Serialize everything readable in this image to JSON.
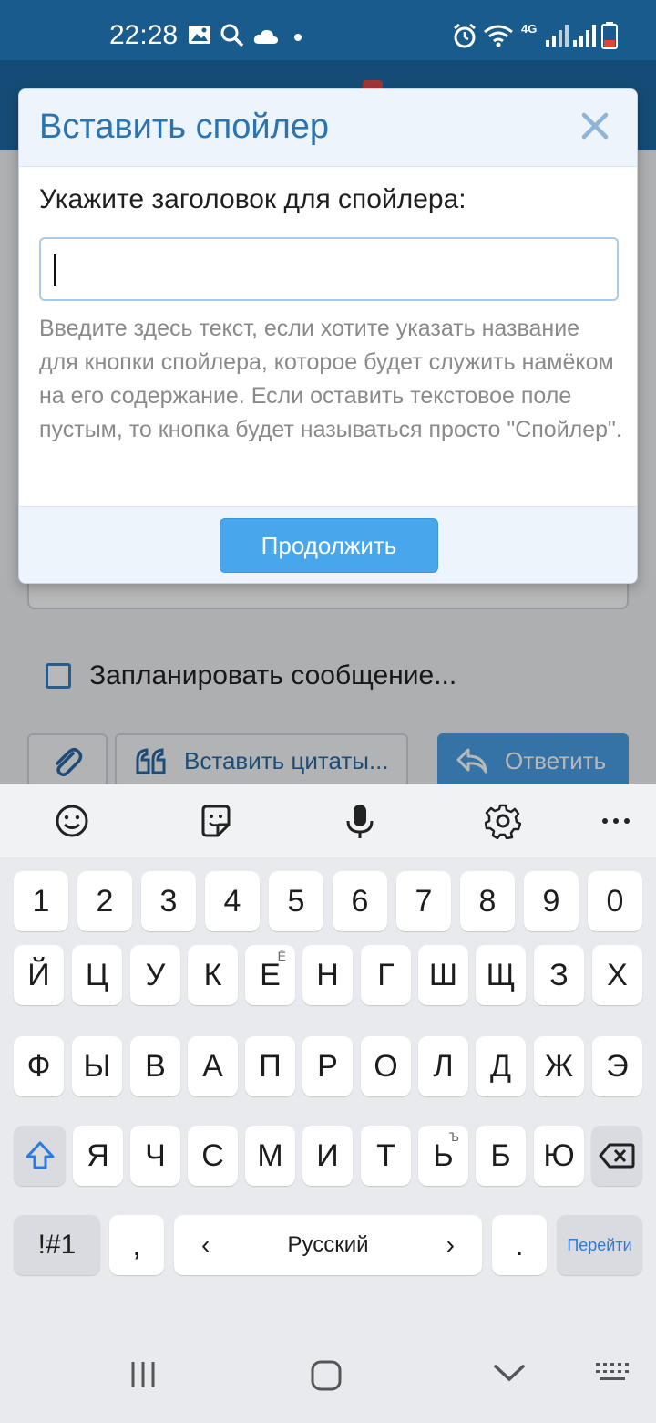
{
  "status_bar": {
    "time": "22:28",
    "network": "4G",
    "icons": [
      "image-icon",
      "search-icon",
      "cloud-icon",
      "dot-icon",
      "alarm-icon",
      "wifi-icon",
      "signal-icon",
      "signal-icon",
      "battery-icon"
    ]
  },
  "background": {
    "schedule_label": "Запланировать сообщение...",
    "insert_quotes_label": "Вставить цитаты...",
    "reply_label": "Ответить"
  },
  "dialog": {
    "title": "Вставить спойлер",
    "field_label": "Укажите заголовок для спойлера:",
    "input_value": "",
    "hint": "Введите здесь текст, если хотите указать название для кнопки спойлера, которое будет служить намёком на его содержание. Если оставить текстовое поле пустым, то кнопка будет называться просто \"Спойлер\".",
    "continue_label": "Продолжить"
  },
  "keyboard": {
    "row_digits": [
      "1",
      "2",
      "3",
      "4",
      "5",
      "6",
      "7",
      "8",
      "9",
      "0"
    ],
    "row1": [
      "Й",
      "Ц",
      "У",
      "К",
      "Е",
      "Н",
      "Г",
      "Ш",
      "Щ",
      "З",
      "Х"
    ],
    "row1_sup_e": "Ё",
    "row2": [
      "Ф",
      "Ы",
      "В",
      "А",
      "П",
      "Р",
      "О",
      "Л",
      "Д",
      "Ж",
      "Э"
    ],
    "row3": [
      "Я",
      "Ч",
      "С",
      "М",
      "И",
      "Т",
      "Ь",
      "Б",
      "Ю"
    ],
    "row3_sup_soft": "Ъ",
    "symbols_label": "!#1",
    "comma": ",",
    "period": ".",
    "space_label": "Русский",
    "left_arrow": "‹",
    "right_arrow": "›",
    "go_label": "Перейти"
  },
  "colors": {
    "status_bar": "#195b8c",
    "app_header": "#1e6aa5",
    "accent": "#47a6ec",
    "dialog_title": "#2a74b1"
  }
}
